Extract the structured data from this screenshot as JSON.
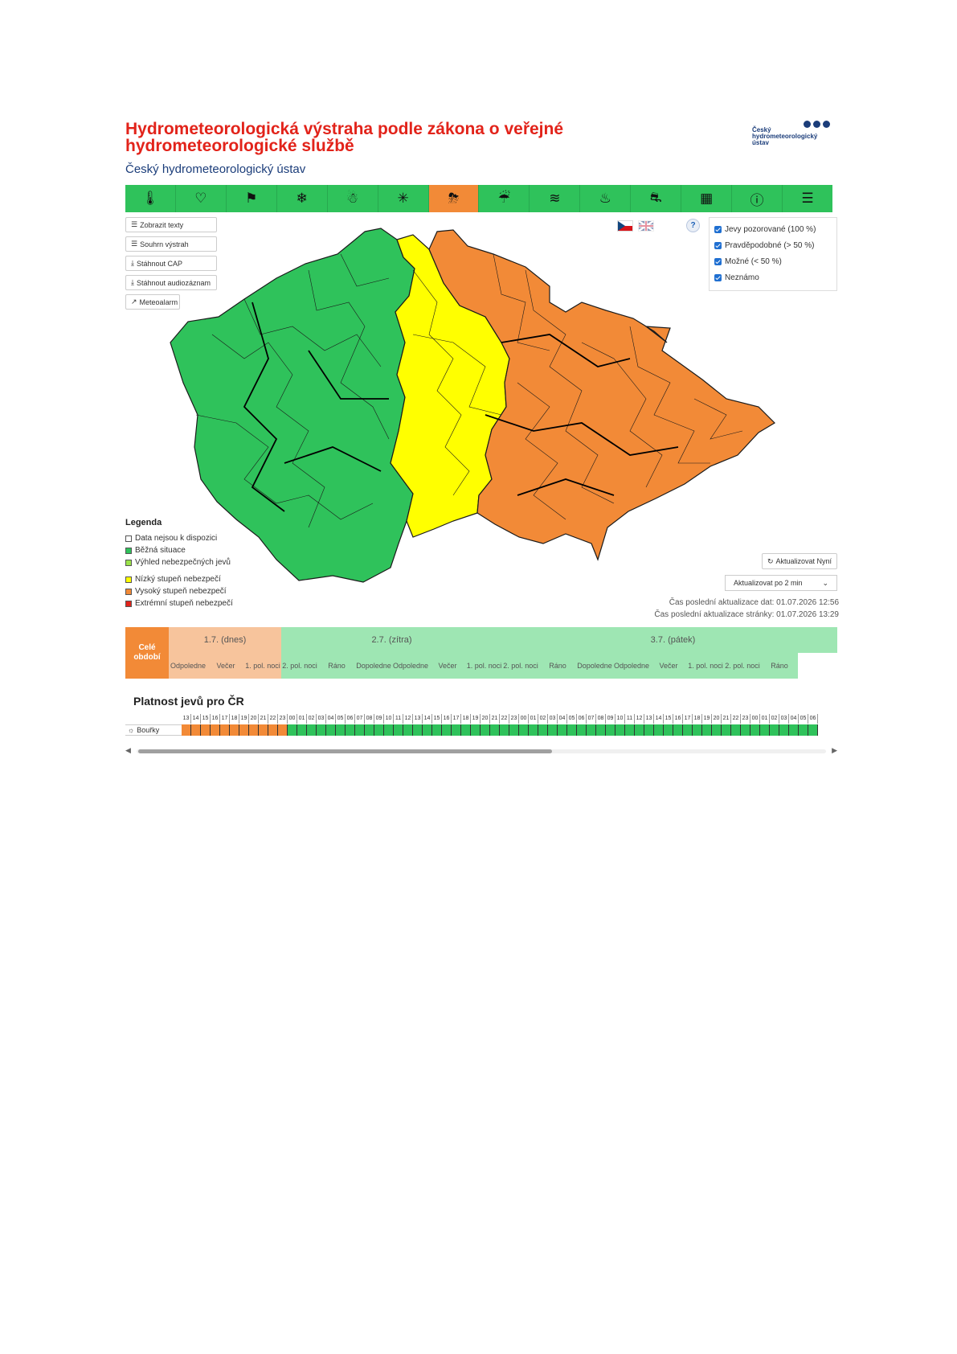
{
  "header": {
    "title": "Hydrometeorologická výstraha podle zákona o veřejné hydrometeorologické službě",
    "subtitle": "Český hydrometeorologický ústav",
    "logo_text_1": "Český",
    "logo_text_2": "hydrometeorologický",
    "logo_text_3": "ústav"
  },
  "toolbar": {
    "items": [
      {
        "icon": "thermometer-icon",
        "glyph": "🌡"
      },
      {
        "icon": "heart-pulse-icon",
        "glyph": "♡"
      },
      {
        "icon": "windsock-icon",
        "glyph": "⚑"
      },
      {
        "icon": "snow-icon",
        "glyph": "❄"
      },
      {
        "icon": "snow-drift-icon",
        "glyph": "☃"
      },
      {
        "icon": "frost-icon",
        "glyph": "✳"
      },
      {
        "icon": "thunderstorm-icon",
        "glyph": "⛈"
      },
      {
        "icon": "rain-icon",
        "glyph": "☔"
      },
      {
        "icon": "flood-icon",
        "glyph": "≋"
      },
      {
        "icon": "fire-icon",
        "glyph": "♨"
      },
      {
        "icon": "road-icon",
        "glyph": "⛐"
      },
      {
        "icon": "smog-icon",
        "glyph": "▦"
      },
      {
        "icon": "warning-icon",
        "glyph": "ⓘ"
      },
      {
        "icon": "list-icon",
        "glyph": "☰"
      }
    ],
    "active_index": 6
  },
  "buttons": {
    "show_texts": "Zobrazit texty",
    "summary": "Souhrn výstrah",
    "download_cap": "Stáhnout CAP",
    "download_audio": "Stáhnout audiozáznam",
    "meteoalarm": "Meteoalarm"
  },
  "checkboxes": [
    {
      "label": "Jevy pozorované (100 %)",
      "checked": true
    },
    {
      "label": "Pravděpodobné (> 50 %)",
      "checked": true
    },
    {
      "label": "Možné (< 50 %)",
      "checked": true
    },
    {
      "label": "Neznámo",
      "checked": true
    }
  ],
  "help": "?",
  "legend": {
    "title": "Legenda",
    "items": [
      {
        "label": "Data nejsou k dispozici",
        "color": "#ffffff"
      },
      {
        "label": "Běžná situace",
        "color": "#2fc25b"
      },
      {
        "label": "Výhled nebezpečných jevů",
        "color": "#9be34a"
      },
      {
        "label": "Nízký stupeň nebezpečí",
        "color": "#ffff00"
      },
      {
        "label": "Vysoký stupeň nebezpečí",
        "color": "#f28a37"
      },
      {
        "label": "Extrémní stupeň nebezpečí",
        "color": "#e2231a"
      }
    ]
  },
  "controls": {
    "refresh_label": "Aktualizovat Nyní",
    "auto_refresh_value": "Aktualizovat po 2 min",
    "last_data_update": "Čas poslední aktualizace dat: 01.07.2026 12:56",
    "last_page_update": "Čas poslední aktualizace stránky: 01.07.2026 13:29"
  },
  "timeline": {
    "whole_period": "Celé období",
    "days": [
      {
        "label": "1.7. (dnes)",
        "color": "#f7c49c",
        "width": 140
      },
      {
        "label": "2.7. (zítra)",
        "color": "#9ee6b3",
        "width": 275
      },
      {
        "label": "3.7. (pátek)",
        "color": "#9ee6b3",
        "width": 425
      }
    ],
    "parts": [
      {
        "label": "Odpoledne",
        "color": "#f7c49c",
        "width": 48
      },
      {
        "label": "Večer",
        "color": "#f7c49c",
        "width": 46
      },
      {
        "label": "1. pol. noci",
        "color": "#f7c49c",
        "width": 46
      },
      {
        "label": "2. pol. noci",
        "color": "#9ee6b3",
        "width": 46
      },
      {
        "label": "Ráno",
        "color": "#9ee6b3",
        "width": 46
      },
      {
        "label": "Dopoledne",
        "color": "#9ee6b3",
        "width": 46
      },
      {
        "label": "Odpoledne",
        "color": "#9ee6b3",
        "width": 46
      },
      {
        "label": "Večer",
        "color": "#9ee6b3",
        "width": 46
      },
      {
        "label": "1. pol. noci",
        "color": "#9ee6b3",
        "width": 45
      },
      {
        "label": "2. pol. noci",
        "color": "#9ee6b3",
        "width": 46
      },
      {
        "label": "Ráno",
        "color": "#9ee6b3",
        "width": 46
      },
      {
        "label": "Dopoledne",
        "color": "#9ee6b3",
        "width": 46
      },
      {
        "label": "Odpoledne",
        "color": "#9ee6b3",
        "width": 46
      },
      {
        "label": "Večer",
        "color": "#9ee6b3",
        "width": 46
      },
      {
        "label": "1. pol. noci",
        "color": "#9ee6b3",
        "width": 46
      },
      {
        "label": "2. pol. noci",
        "color": "#9ee6b3",
        "width": 46
      },
      {
        "label": "Ráno",
        "color": "#9ee6b3",
        "width": 46
      }
    ]
  },
  "validity": {
    "title": "Platnost jevů pro ČR",
    "row_label": "Bouřky",
    "hours": [
      "13",
      "14",
      "15",
      "16",
      "17",
      "18",
      "19",
      "20",
      "21",
      "22",
      "23",
      "00",
      "01",
      "02",
      "03",
      "04",
      "05",
      "06",
      "07",
      "08",
      "09",
      "10",
      "11",
      "12",
      "13",
      "14",
      "15",
      "16",
      "17",
      "18",
      "19",
      "20",
      "21",
      "22",
      "23",
      "00",
      "01",
      "02",
      "03",
      "04",
      "05",
      "06",
      "07",
      "08",
      "09",
      "10",
      "11",
      "12",
      "13",
      "14",
      "15",
      "16",
      "17",
      "18",
      "19",
      "20",
      "21",
      "22",
      "23",
      "00",
      "01",
      "02",
      "03",
      "04",
      "05",
      "06"
    ],
    "orange_count": 11,
    "colors": {
      "orange": "#f28a37",
      "green": "#2fc25b"
    }
  }
}
